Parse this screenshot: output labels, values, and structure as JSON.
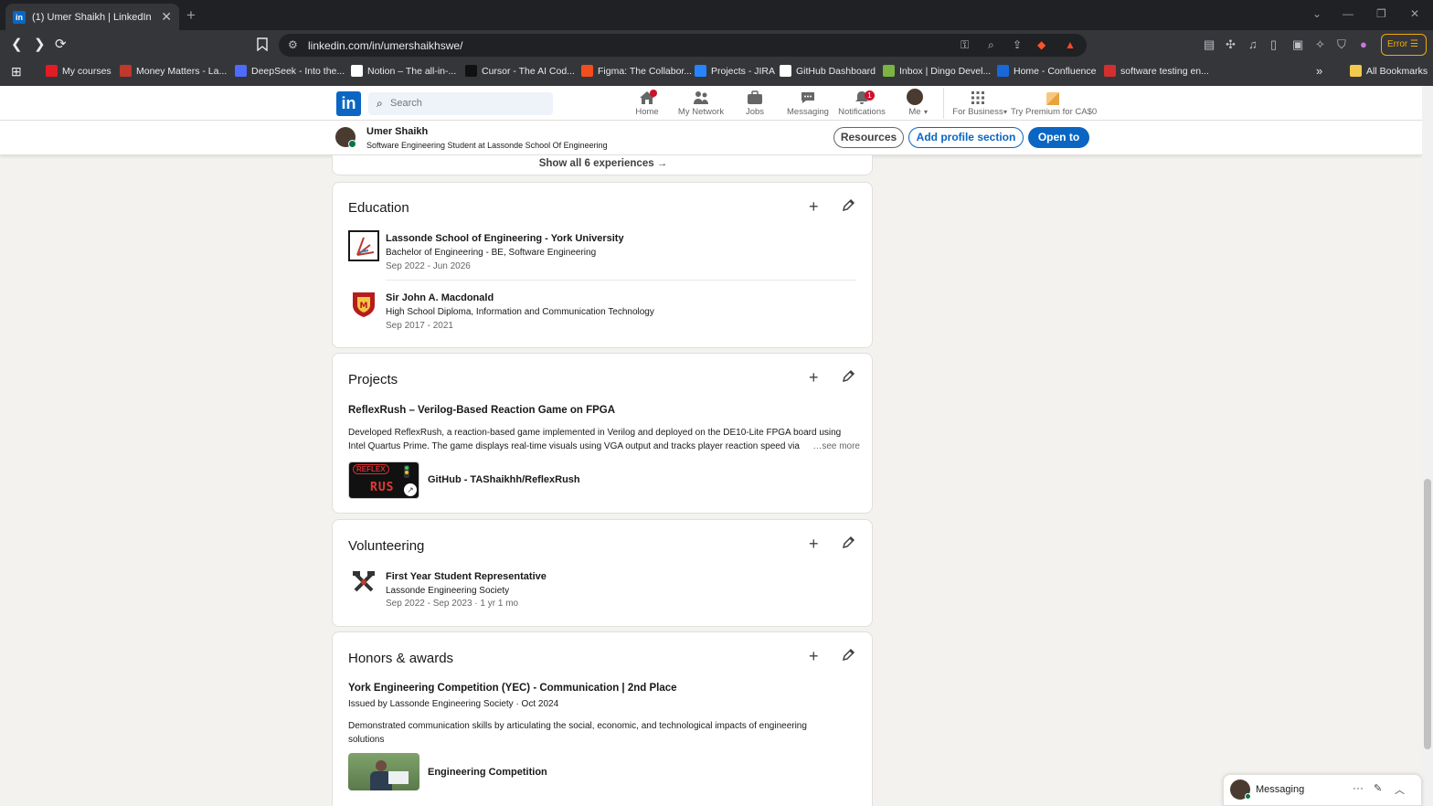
{
  "browser": {
    "tab_title": "(1) Umer Shaikh | LinkedIn",
    "url": "linkedin.com/in/umershaikhswe/",
    "error_label": "Error",
    "bookmarks": [
      {
        "label": "My courses",
        "color": "#e31b23"
      },
      {
        "label": "Money Matters - La...",
        "color": "#c0392b"
      },
      {
        "label": "DeepSeek - Into the...",
        "color": "#4d6bfe"
      },
      {
        "label": "Notion – The all-in-...",
        "color": "#ffffff"
      },
      {
        "label": "Cursor - The AI Cod...",
        "color": "#111111"
      },
      {
        "label": "Figma: The Collabor...",
        "color": "#f24e1e"
      },
      {
        "label": "Projects - JIRA",
        "color": "#2684ff"
      },
      {
        "label": "GitHub Dashboard",
        "color": "#ffffff"
      },
      {
        "label": "Inbox | Dingo Devel...",
        "color": "#7cb342"
      },
      {
        "label": "Home - Confluence",
        "color": "#1868db"
      },
      {
        "label": "software testing en...",
        "color": "#d32f2f"
      }
    ],
    "all_bookmarks": "All Bookmarks"
  },
  "linkedin": {
    "logo": "in",
    "search_placeholder": "Search",
    "nav": [
      {
        "label": "Home",
        "icon": "home-icon"
      },
      {
        "label": "My Network",
        "icon": "network-icon"
      },
      {
        "label": "Jobs",
        "icon": "jobs-icon"
      },
      {
        "label": "Messaging",
        "icon": "messaging-icon"
      },
      {
        "label": "Notifications",
        "icon": "bell-icon",
        "badge": "1"
      },
      {
        "label": "Me",
        "icon": "avatar"
      },
      {
        "label": "For Business",
        "icon": "grid-icon"
      },
      {
        "label": "Try Premium for CA$0",
        "icon": "premium-icon"
      }
    ]
  },
  "profile_bar": {
    "name": "Umer Shaikh",
    "headline": "Software Engineering Student at Lassonde School Of Engineering",
    "resources": "Resources",
    "add_section": "Add profile section",
    "open_to": "Open to"
  },
  "experience": {
    "show_all": "Show all 6 experiences →"
  },
  "education": {
    "title": "Education",
    "items": [
      {
        "school": "Lassonde School of Engineering - York University",
        "degree": "Bachelor of Engineering - BE, Software Engineering",
        "dates": "Sep 2022 - Jun 2026"
      },
      {
        "school": "Sir John A. Macdonald",
        "degree": "High School Diploma, Information and Communication Technology",
        "dates": "Sep 2017 - 2021"
      }
    ]
  },
  "projects": {
    "title": "Projects",
    "project_title": "ReflexRush – Verilog-Based Reaction Game on FPGA",
    "desc_line1": "Developed ReflexRush, a reaction-based game implemented in Verilog and deployed on the DE10-Lite FPGA board using",
    "desc_line2": "Intel Quartus Prime. The game displays real-time visuals using VGA output and tracks player reaction speed via",
    "see_more": "…see more",
    "link_label": "GitHub - TAShaikhh/ReflexRush",
    "thumb_text_top": "REFLEX",
    "thumb_text_bottom": "RUS"
  },
  "volunteering": {
    "title": "Volunteering",
    "role": "First Year Student Representative",
    "org": "Lassonde Engineering Society",
    "dates": "Sep 2022 - Sep 2023 · 1 yr 1 mo"
  },
  "honors": {
    "title": "Honors & awards",
    "award_title": "York Engineering Competition (YEC) - Communication | 2nd Place",
    "issuer": "Issued by Lassonde Engineering Society · Oct 2024",
    "desc_line1": "Demonstrated communication skills by articulating the social, economic, and technological impacts of engineering",
    "desc_line2": "solutions",
    "media_label": "Engineering Competition"
  },
  "messaging": {
    "label": "Messaging"
  }
}
